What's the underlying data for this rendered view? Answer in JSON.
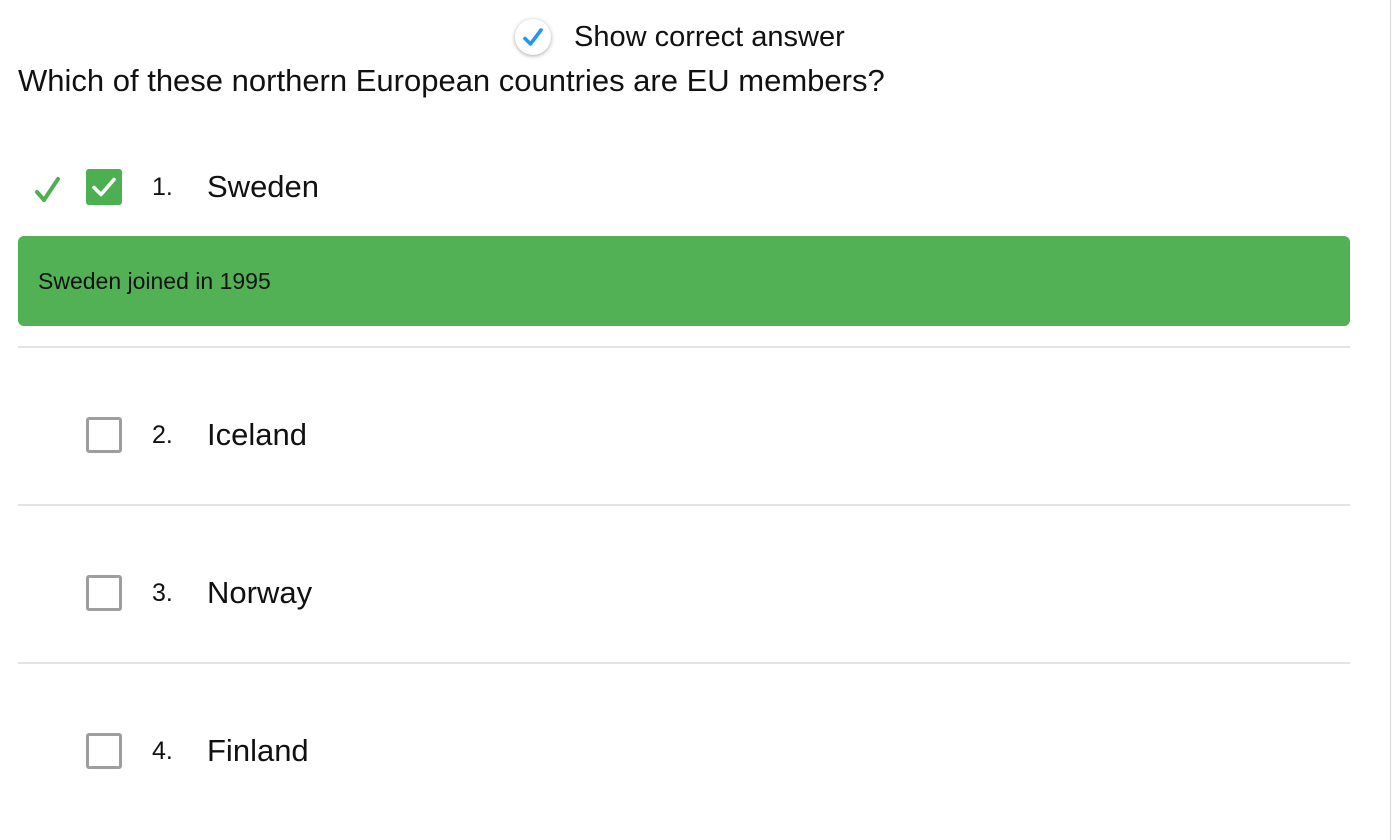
{
  "show_correct_answer": {
    "label": "Show correct answer",
    "checked": true,
    "icon": "check-icon",
    "accent_color": "#2196f3"
  },
  "question": {
    "text": "Which of these northern European countries are EU members?"
  },
  "options": [
    {
      "number": "1.",
      "label": "Sweden",
      "checked": true,
      "marked_correct": true
    },
    {
      "number": "2.",
      "label": "Iceland",
      "checked": false,
      "marked_correct": false
    },
    {
      "number": "3.",
      "label": "Norway",
      "checked": false,
      "marked_correct": false
    },
    {
      "number": "4.",
      "label": "Finland",
      "checked": false,
      "marked_correct": false
    }
  ],
  "feedback": {
    "text": "Sweden joined in 1995",
    "color": "#52b055"
  },
  "colors": {
    "correct_green": "#4caf50",
    "checkbox_border": "#9e9e9e",
    "divider": "#e3e3e3"
  }
}
